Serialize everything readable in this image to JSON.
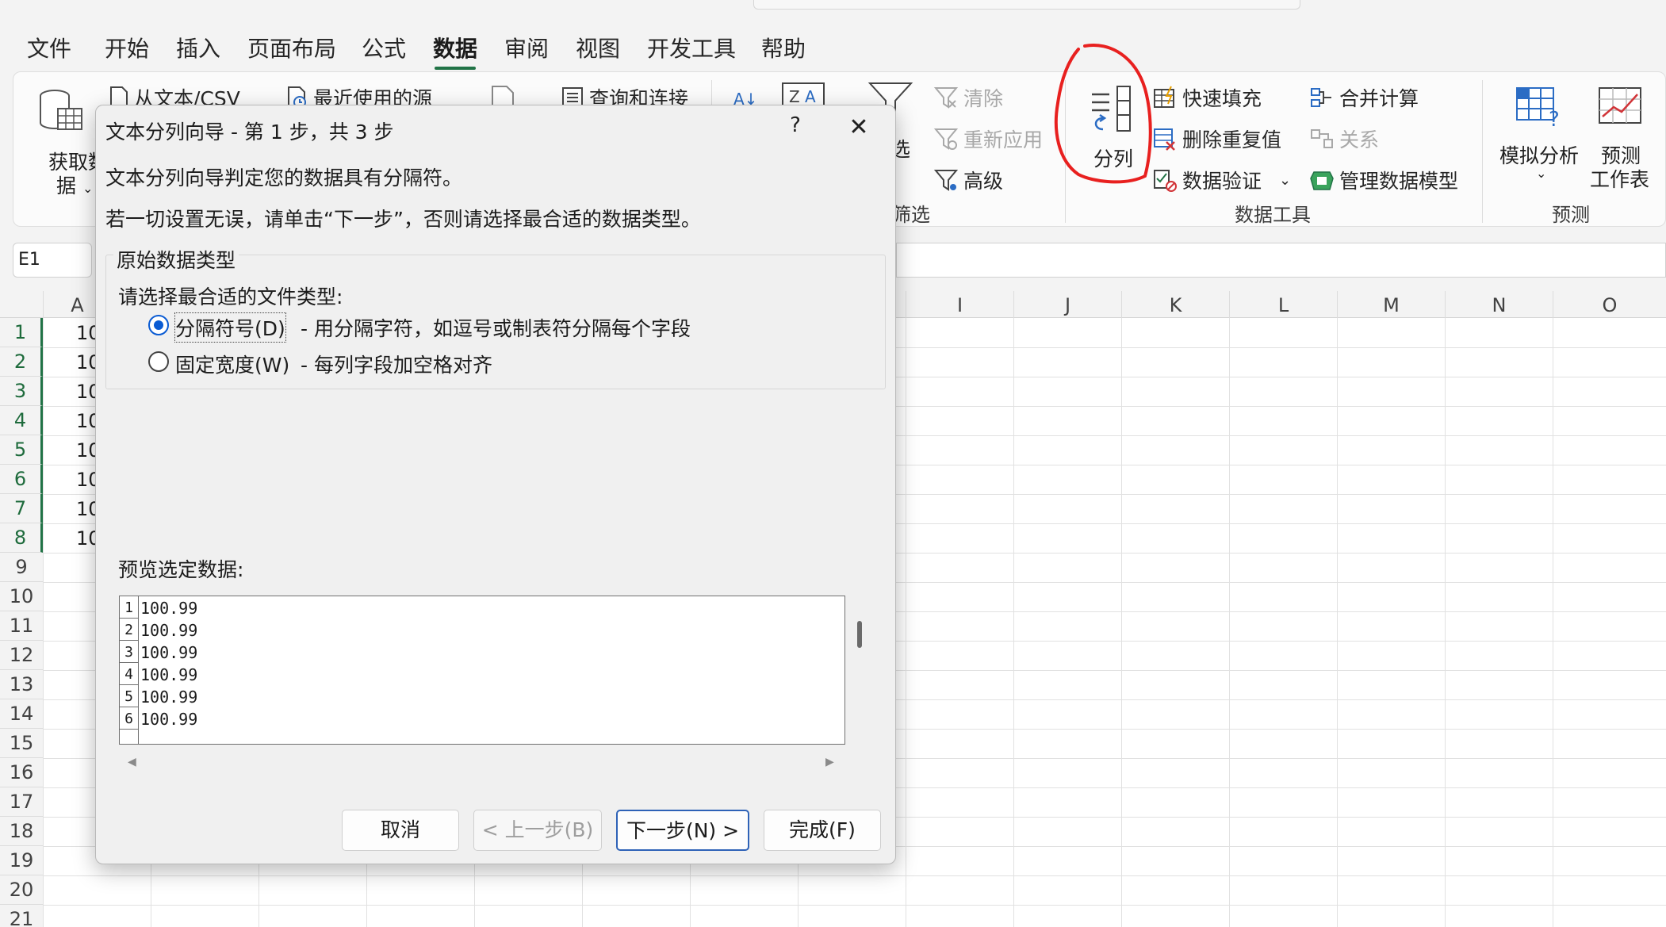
{
  "menu": {
    "tabs": [
      "文件",
      "开始",
      "插入",
      "页面布局",
      "公式",
      "数据",
      "审阅",
      "视图",
      "开发工具",
      "帮助"
    ],
    "active": "数据"
  },
  "ribbon": {
    "get_data_line1": "获取数",
    "get_data_line2": "据",
    "from_text_csv": "从文本/CSV",
    "recent_sources": "最近使用的源",
    "queries_connections": "查询和连接",
    "sort_az_partial": "A↓",
    "filter_partial": "选",
    "filter_group_partial": "筛选",
    "clear": "清除",
    "reapply": "重新应用",
    "advanced": "高级",
    "text_to_columns": "分列",
    "flash_fill": "快速填充",
    "remove_duplicates": "删除重复值",
    "data_validation": "数据验证",
    "consolidate": "合并计算",
    "relationships": "关系",
    "manage_data_model": "管理数据模型",
    "data_tools_group": "数据工具",
    "what_if": "模拟分析",
    "forecast_line1": "预测",
    "forecast_line2": "工作表",
    "forecast_group": "预测"
  },
  "namebox": "E1",
  "columns": [
    "A",
    "I",
    "J",
    "K",
    "L",
    "M",
    "N",
    "O"
  ],
  "rows": [
    "1",
    "2",
    "3",
    "4",
    "5",
    "6",
    "7",
    "8",
    "9",
    "10",
    "11",
    "12",
    "13",
    "14",
    "15",
    "16",
    "17",
    "18",
    "19",
    "20",
    "21"
  ],
  "cellA_partial": [
    "10",
    "10",
    "10",
    "10",
    "10",
    "10",
    "10",
    "10"
  ],
  "dialog": {
    "title": "文本分列向导 - 第 1 步，共 3 步",
    "help": "?",
    "close": "✕",
    "line1": "文本分列向导判定您的数据具有分隔符。",
    "line2": "若一切设置无误，请单击“下一步”，否则请选择最合适的数据类型。",
    "group_legend": "原始数据类型",
    "choose_label": "请选择最合适的文件类型:",
    "option1_label": "分隔符号(D)",
    "option1_desc": "- 用分隔字符，如逗号或制表符分隔每个字段",
    "option2_label": "固定宽度(W)",
    "option2_desc": "- 每列字段加空格对齐",
    "preview_label": "预览选定数据:",
    "preview_rows": [
      {
        "n": "1",
        "v": "100.99"
      },
      {
        "n": "2",
        "v": "100.99"
      },
      {
        "n": "3",
        "v": "100.99"
      },
      {
        "n": "4",
        "v": "100.99"
      },
      {
        "n": "5",
        "v": "100.99"
      },
      {
        "n": "6",
        "v": "100.99"
      }
    ],
    "btn_cancel": "取消",
    "btn_back": "< 上一步(B)",
    "btn_next": "下一步(N) >",
    "btn_finish": "完成(F)"
  },
  "colors": {
    "accent": "#217346",
    "annotation": "#e8201f",
    "radio": "#0a5bd3"
  }
}
